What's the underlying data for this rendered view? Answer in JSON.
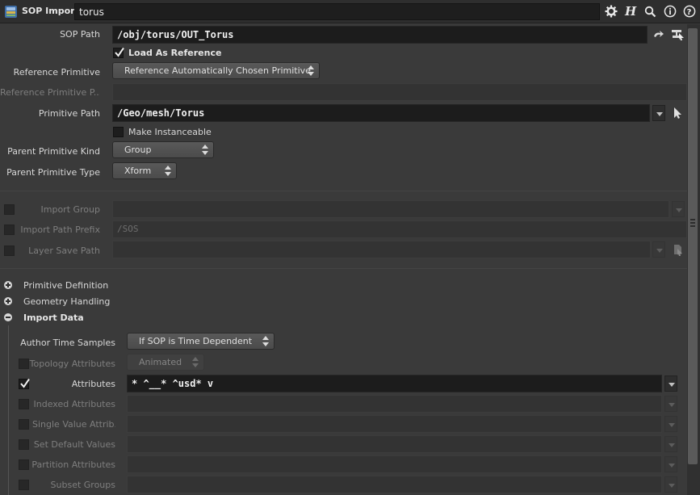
{
  "header": {
    "node_type": "SOP Import",
    "node_name": "torus",
    "icons": [
      "gear-icon",
      "help-h-icon",
      "search-icon",
      "info-icon",
      "question-icon"
    ]
  },
  "params": {
    "sop_path": {
      "label": "SOP Path",
      "value": "/obj/torus/OUT_Torus"
    },
    "load_as_reference": {
      "label": "Load As Reference",
      "checked": true
    },
    "reference_primitive": {
      "label": "Reference Primitive",
      "value": "Reference Automatically Chosen Primitive"
    },
    "reference_primitive_path": {
      "label": "Reference Primitive P...",
      "value": ""
    },
    "primitive_path": {
      "label": "Primitive Path",
      "value": "/Geo/mesh/Torus"
    },
    "make_instanceable": {
      "label": "Make Instanceable",
      "checked": false
    },
    "parent_primitive_kind": {
      "label": "Parent Primitive Kind",
      "value": "Group"
    },
    "parent_primitive_type": {
      "label": "Parent Primitive Type",
      "value": "Xform"
    },
    "import_group": {
      "label": "Import Group",
      "value": ""
    },
    "import_path_prefix": {
      "label": "Import Path Prefix",
      "value": "/SOS"
    },
    "layer_save_path": {
      "label": "Layer Save Path",
      "value": ""
    }
  },
  "folders": {
    "primitive_definition": {
      "label": "Primitive Definition",
      "expanded": false
    },
    "geometry_handling": {
      "label": "Geometry Handling",
      "expanded": false
    },
    "import_data": {
      "label": "Import Data",
      "expanded": true
    }
  },
  "import_data": {
    "author_time_samples": {
      "label": "Author Time Samples",
      "value": "If SOP is Time Dependent"
    },
    "topology_attributes": {
      "label": "Topology Attributes",
      "value": "Animated"
    },
    "attributes": {
      "label": "Attributes",
      "value": "* ^__* ^usd* v",
      "checked": true
    },
    "indexed_attributes": {
      "label": "Indexed Attributes",
      "value": ""
    },
    "single_value_attributes": {
      "label": "Single Value Attrib...",
      "value": ""
    },
    "set_default_values": {
      "label": "Set Default Values",
      "value": ""
    },
    "partition_attributes": {
      "label": "Partition Attributes",
      "value": ""
    },
    "subset_groups": {
      "label": "Subset Groups",
      "value": ""
    }
  },
  "colors": {
    "background": "#3a3a3a",
    "field": "#1c1c1c",
    "menu": "#525252"
  }
}
